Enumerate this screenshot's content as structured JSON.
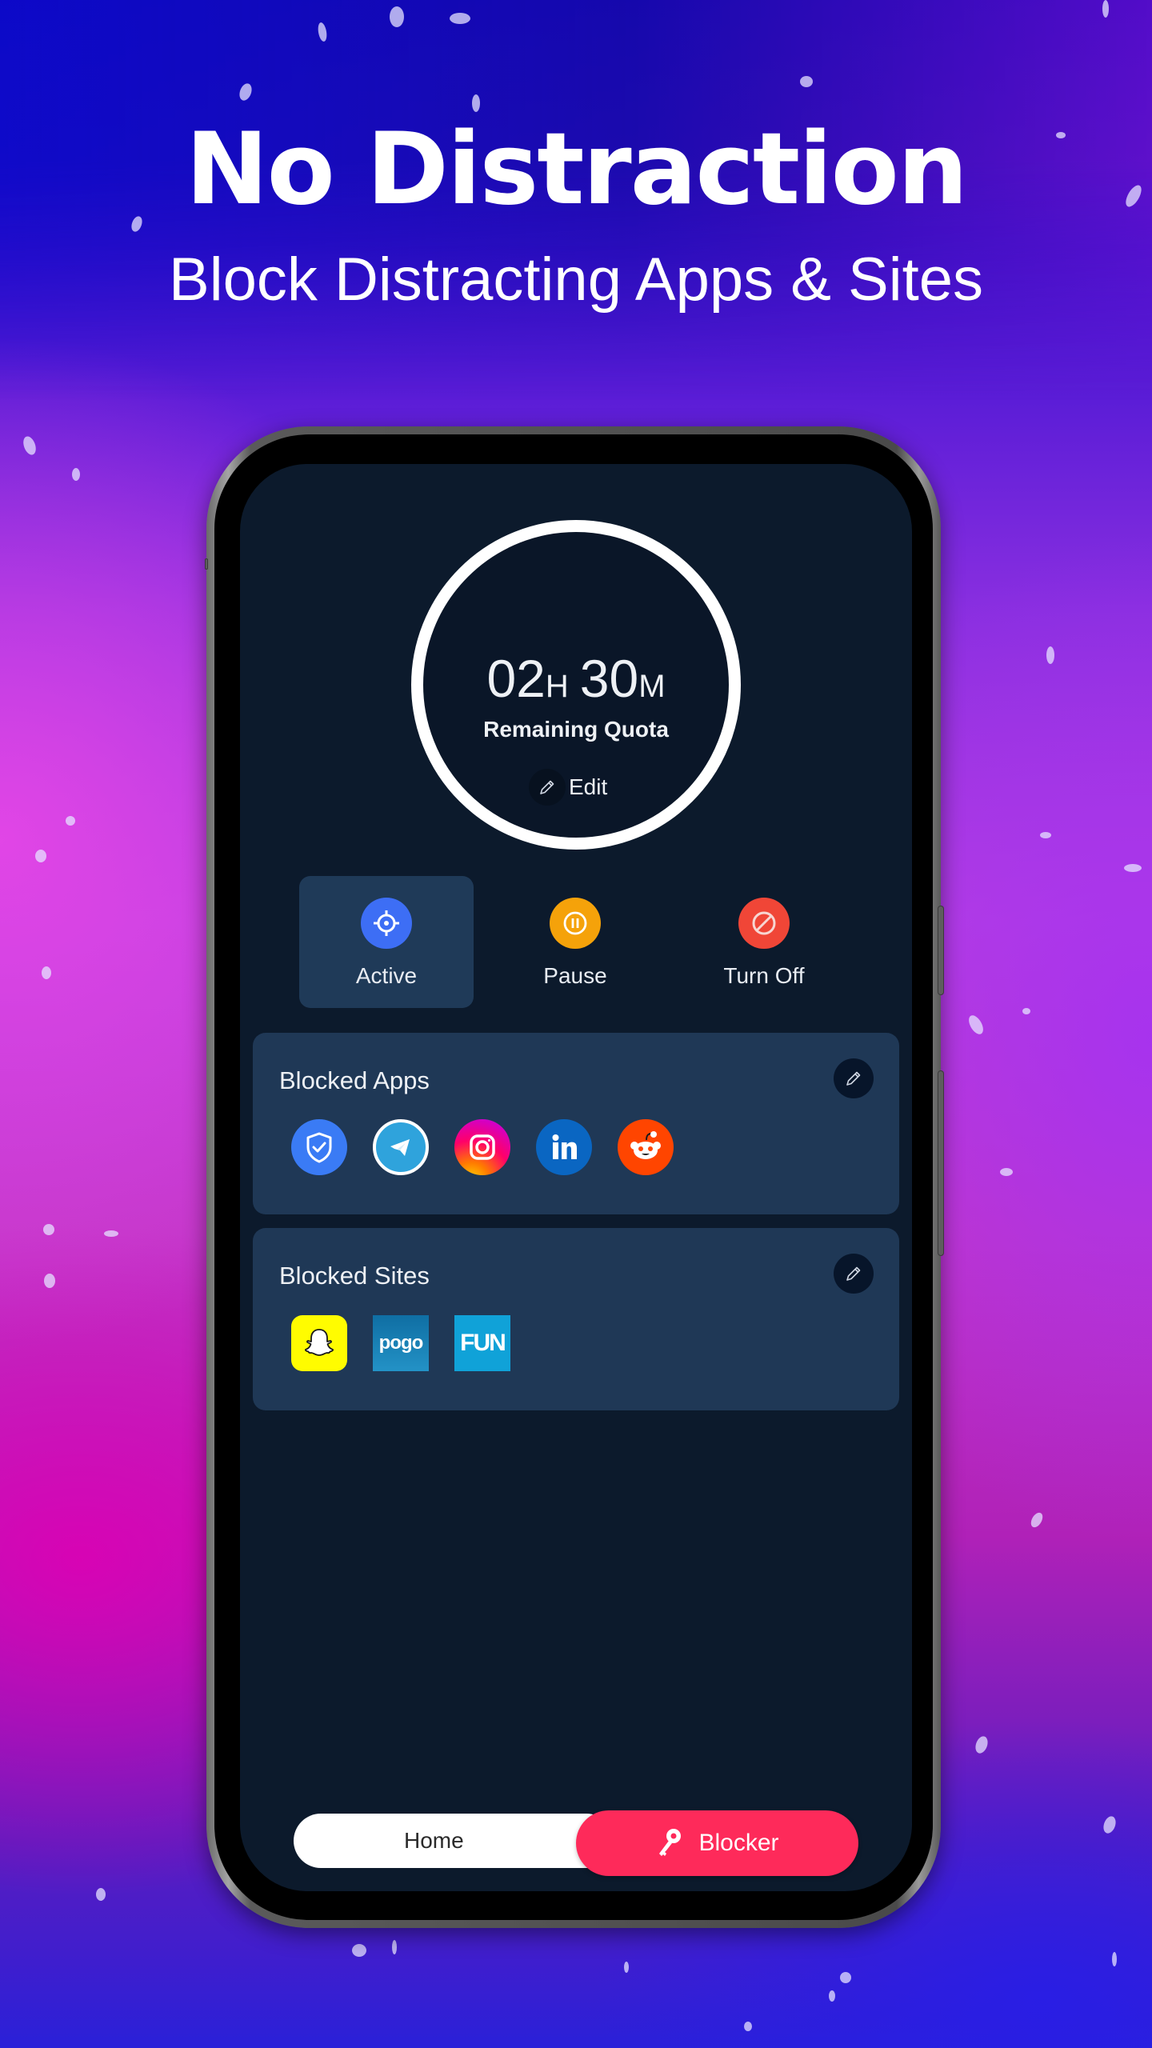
{
  "promo": {
    "headline": "No Distraction",
    "subheadline": "Block Distracting Apps & Sites"
  },
  "quota": {
    "hours": "02",
    "hours_unit": "H",
    "minutes": "30",
    "minutes_unit": "M",
    "label": "Remaining Quota",
    "edit_label": "Edit",
    "edit_icon": "pencil-icon"
  },
  "modes": [
    {
      "label": "Active",
      "icon": "crosshair-icon",
      "color": "#3d6ef5",
      "selected": true
    },
    {
      "label": "Pause",
      "icon": "pause-circle-icon",
      "color": "#f5a20a",
      "selected": false
    },
    {
      "label": "Turn Off",
      "icon": "block-icon",
      "color": "#f04637",
      "selected": false
    }
  ],
  "blocked_apps": {
    "title": "Blocked Apps",
    "edit_icon": "pencil-icon",
    "apps": [
      {
        "name": "Security Shield",
        "icon": "shield-check-icon",
        "color": "#3a7bf5"
      },
      {
        "name": "Telegram",
        "icon": "telegram-icon",
        "color": "#2fa3dc"
      },
      {
        "name": "Instagram",
        "icon": "instagram-icon",
        "color": "#e1306c"
      },
      {
        "name": "LinkedIn",
        "icon": "linkedin-icon",
        "color": "#0a66c2"
      },
      {
        "name": "Reddit",
        "icon": "reddit-icon",
        "color": "#ff4500"
      }
    ]
  },
  "blocked_sites": {
    "title": "Blocked Sites",
    "edit_icon": "pencil-icon",
    "sites": [
      {
        "name": "Snapchat",
        "icon": "snapchat-icon",
        "color": "#fffc00"
      },
      {
        "name": "pogo",
        "icon": "pogo-logo",
        "color": "#1a7db4",
        "text": "pogo"
      },
      {
        "name": "FUN",
        "icon": "fun-logo",
        "color": "#10a2d8",
        "text": "FUN"
      }
    ]
  },
  "bottom_nav": {
    "home_label": "Home",
    "blocker_label": "Blocker",
    "blocker_icon": "key-icon",
    "active": "Blocker",
    "accent_color": "#fe2a5a"
  },
  "theme": {
    "screen_bg": "#0c1a2c",
    "card_bg": "#1f3856"
  }
}
